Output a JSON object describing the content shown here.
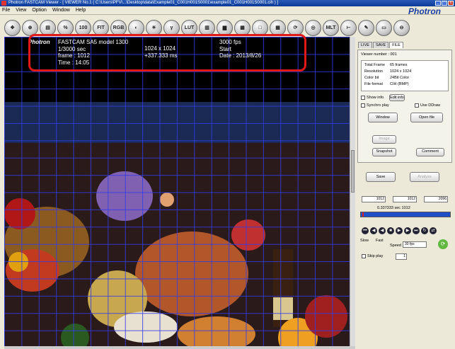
{
  "window": {
    "title": "Photron FASTCAM Viewer - [ VIEWER No.1 ( C:\\Users\\PFV\\...\\Desktop\\data\\Example01_C001H001S0001\\example01_C001H001S0001.cih ) ]"
  },
  "menu": {
    "items": [
      "File",
      "View",
      "Option",
      "Window",
      "Help"
    ],
    "brand": "Photron"
  },
  "toolbar": {
    "buttons": [
      {
        "icon": "move-icon",
        "label": "✥"
      },
      {
        "icon": "zoom-icon",
        "label": "⊕"
      },
      {
        "icon": "clipboard-icon",
        "label": "▤"
      },
      {
        "icon": "percent-icon",
        "label": "%"
      },
      {
        "icon": "zoom-100-icon",
        "label": "100"
      },
      {
        "icon": "fit-icon",
        "label": "FIT"
      },
      {
        "icon": "rgb-icon",
        "label": "RGB"
      },
      {
        "icon": "contrast-icon",
        "label": "◐"
      },
      {
        "icon": "brightness-icon",
        "label": "☀"
      },
      {
        "icon": "gamma-icon",
        "label": "γ"
      },
      {
        "icon": "lut-reset-icon",
        "label": "LUT"
      },
      {
        "icon": "color-icon",
        "label": "▥"
      },
      {
        "icon": "histogram-icon",
        "label": "▆"
      },
      {
        "icon": "image-icon",
        "label": "▦"
      },
      {
        "icon": "monitor-icon",
        "label": "□"
      },
      {
        "icon": "grid-icon",
        "label": "▦"
      },
      {
        "icon": "refresh-icon",
        "label": "⟳"
      },
      {
        "icon": "camera-icon",
        "label": "◎"
      },
      {
        "icon": "multi-icon",
        "label": "MLT"
      },
      {
        "icon": "ruler-icon",
        "label": "⊢"
      },
      {
        "icon": "pen-icon",
        "label": "✎"
      },
      {
        "icon": "display-icon",
        "label": "▭"
      },
      {
        "icon": "minus-icon",
        "label": "⊖"
      }
    ]
  },
  "overlay": {
    "brand": "Photron",
    "camera": "FASTCAM SA5 model 1300",
    "shutter": "1/3000 sec",
    "frame": "frame : 1012",
    "time": "Time : 14:05",
    "resolution": "1024 x 1024",
    "elapsed": "+337.333 ms",
    "fps": "3000 fps",
    "trigger": "Start",
    "date": "Date : 2013/8/26"
  },
  "panel": {
    "tabs": [
      "LIVE",
      "SAVE",
      "FILE"
    ],
    "viewer_number": "Viewer number : 001",
    "info": [
      {
        "k": "Total Frame",
        "v": "65 frames"
      },
      {
        "k": "Resolution",
        "v": "1024 x 1024"
      },
      {
        "k": "Color bit",
        "v": "24Bit Color"
      },
      {
        "k": "File format",
        "v": "CIH (BMP)"
      }
    ],
    "show_info": "Show info",
    "edit_info": "Edit info",
    "sync_play": "Synchro play",
    "use_ddraw": "Use DDraw",
    "window_btn": "Window",
    "open_file": "Open file",
    "image_btn": "Image",
    "snapshot_btn": "Snapshot",
    "comment_btn": "Comment",
    "save_btn": "Save",
    "analyze_btn": "Analyze",
    "frame_start": "1012",
    "frame_current": "1012",
    "frame_end": "2096",
    "time_readout": "0.337333 sec 1012",
    "slow_label": "Slow",
    "fast_label": "Fast",
    "speed_label": "Speed",
    "speed_value": "30 fps",
    "skip_play": "Skip play",
    "skip_value": "1"
  }
}
